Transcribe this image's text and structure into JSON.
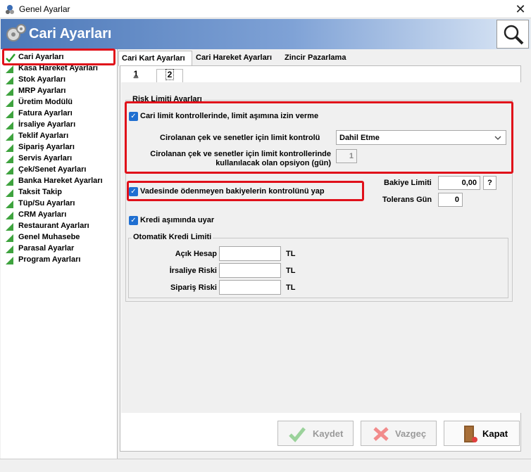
{
  "window": {
    "title": "Genel Ayarlar",
    "close_icon": "close-icon"
  },
  "header": {
    "title": "Cari Ayarları"
  },
  "sidebar": {
    "items": [
      {
        "label": "Cari Ayarları",
        "selected": true
      },
      {
        "label": "Kasa Hareket Ayarları"
      },
      {
        "label": "Stok Ayarları"
      },
      {
        "label": "MRP Ayarları"
      },
      {
        "label": "Üretim Modülü"
      },
      {
        "label": "Fatura Ayarları"
      },
      {
        "label": "İrsaliye Ayarları"
      },
      {
        "label": "Teklif Ayarları"
      },
      {
        "label": "Sipariş Ayarları"
      },
      {
        "label": "Servis Ayarları"
      },
      {
        "label": "Çek/Senet Ayarları"
      },
      {
        "label": "Banka Hareket Ayarları"
      },
      {
        "label": "Taksit Takip"
      },
      {
        "label": "Tüp/Su Ayarları"
      },
      {
        "label": "CRM Ayarları"
      },
      {
        "label": "Restaurant Ayarları"
      },
      {
        "label": "Genel Muhasebe"
      },
      {
        "label": "Parasal Ayarlar"
      },
      {
        "label": "Program Ayarları"
      }
    ]
  },
  "tabs": [
    "Cari Kart Ayarları",
    "Cari Hareket Ayarları",
    "Zincir Pazarlama"
  ],
  "subtabs": [
    "1",
    "2"
  ],
  "risk": {
    "group_label": "Risk Limiti Ayarları",
    "limit_check_label": "Cari limit kontrollerinde, limit aşımına izin verme",
    "ciro_label": "Cirolanan çek ve senetler için limit kontrolü",
    "ciro_value": "Dahil Etme",
    "option_label_1": "Cirolanan çek ve senetler için limit kontrollerinde",
    "option_label_2": "kullanılacak olan opsiyon (gün)",
    "option_value": "1",
    "vade_label": "Vadesinde ödenmeyen bakiyelerin kontrolünü yap",
    "bakiye_label": "Bakiye Limiti",
    "bakiye_value": "0,00",
    "help_label": "?",
    "tolerans_label": "Tolerans Gün",
    "tolerans_value": "0",
    "kredi_label": "Kredi aşımında uyar"
  },
  "kredi": {
    "group_label": "Otomatik Kredi Limiti",
    "rows": [
      {
        "label": "Açık Hesap",
        "value": "",
        "unit": "TL"
      },
      {
        "label": "İrsaliye Riski",
        "value": "",
        "unit": "TL"
      },
      {
        "label": "Sipariş Riski",
        "value": "",
        "unit": "TL"
      }
    ]
  },
  "buttons": {
    "save": "Kaydet",
    "cancel": "Vazgeç",
    "close": "Kapat"
  },
  "colors": {
    "accent": "#1f6fd1",
    "highlight": "#e0101a",
    "header": "#4c78b8"
  }
}
